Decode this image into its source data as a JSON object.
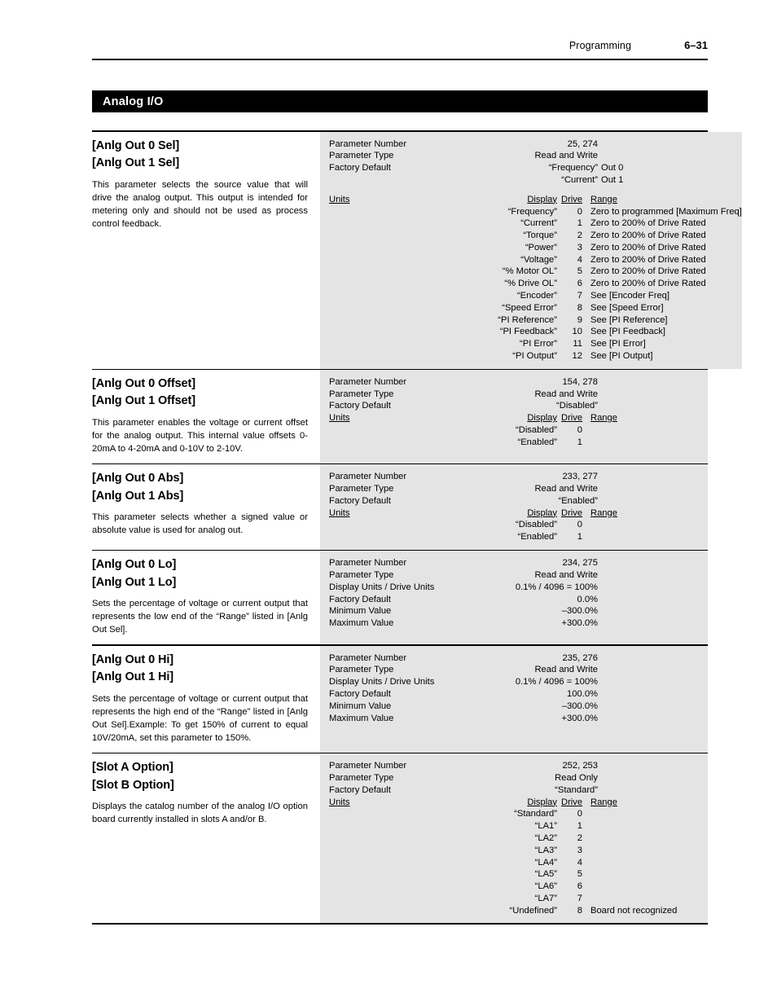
{
  "header": {
    "title": "Programming",
    "folio": "6–31"
  },
  "section": {
    "title": "Analog I/O"
  },
  "labels": {
    "parameter_number": "Parameter Number",
    "parameter_type": "Parameter Type",
    "factory_default": "Factory Default",
    "display_units_drive_units": "Display Units / Drive Units",
    "minimum_value": "Minimum Value",
    "maximum_value": "Maximum Value",
    "units": "Units",
    "col_display": "Display",
    "col_drive": "Drive",
    "col_range": "Range"
  },
  "blocks": [
    {
      "names": [
        "[Anlg Out 0 Sel]",
        "[Anlg Out 1 Sel]"
      ],
      "description": "This parameter selects the source value that will drive the analog output. This output is intended for metering only and should not be used as process control feedback.",
      "parameter_number": "25, 274",
      "parameter_type": "Read and Write",
      "factory_defaults": [
        {
          "value": "“Frequency”",
          "suffix": "Out 0"
        },
        {
          "value": "“Current”",
          "suffix": "Out 1"
        }
      ],
      "has_range_column": true,
      "enums": [
        {
          "display": "“Frequency”",
          "drive": "0",
          "range": "Zero to programmed [Maximum Freq]"
        },
        {
          "display": "“Current”",
          "drive": "1",
          "range": "Zero to 200% of Drive Rated"
        },
        {
          "display": "“Torque”",
          "drive": "2",
          "range": "Zero to 200% of Drive Rated"
        },
        {
          "display": "“Power”",
          "drive": "3",
          "range": "Zero to 200% of Drive Rated"
        },
        {
          "display": "“Voltage”",
          "drive": "4",
          "range": "Zero to 200% of Drive Rated"
        },
        {
          "display": "“% Motor OL”",
          "drive": "5",
          "range": "Zero to 200% of Drive Rated"
        },
        {
          "display": "“% Drive OL”",
          "drive": "6",
          "range": "Zero to 200% of Drive Rated"
        },
        {
          "display": "“Encoder”",
          "drive": "7",
          "range": "See [Encoder Freq]"
        },
        {
          "display": "“Speed Error”",
          "drive": "8",
          "range": "See [Speed Error]"
        },
        {
          "display": "“PI Reference”",
          "drive": "9",
          "range": "See [PI Reference]"
        },
        {
          "display": "“PI Feedback”",
          "drive": "10",
          "range": "See [PI Feedback]"
        },
        {
          "display": "“PI Error”",
          "drive": "11",
          "range": "See [PI Error]"
        },
        {
          "display": "“PI Output”",
          "drive": "12",
          "range": "See [PI Output]"
        }
      ]
    },
    {
      "names": [
        "[Anlg Out 0 Offset]",
        "[Anlg Out 1 Offset]"
      ],
      "description": "This parameter enables the voltage or current offset for the analog output. This internal value offsets 0-20mA to 4-20mA and 0-10V to 2-10V.",
      "parameter_number": "154, 278",
      "parameter_type": "Read and Write",
      "factory_defaults": [
        {
          "value": "“Disabled”",
          "suffix": ""
        }
      ],
      "has_range_column": false,
      "enums": [
        {
          "display": "“Disabled”",
          "drive": "0",
          "range": ""
        },
        {
          "display": "“Enabled”",
          "drive": "1",
          "range": ""
        }
      ]
    },
    {
      "names": [
        "[Anlg Out 0 Abs]",
        "[Anlg Out 1 Abs]"
      ],
      "description": "This parameter selects whether a signed value or absolute value is used for analog out.",
      "parameter_number": "233, 277",
      "parameter_type": "Read and Write",
      "factory_defaults": [
        {
          "value": "“Enabled”",
          "suffix": ""
        }
      ],
      "has_range_column": false,
      "enums": [
        {
          "display": "“Disabled”",
          "drive": "0",
          "range": ""
        },
        {
          "display": "“Enabled”",
          "drive": "1",
          "range": ""
        }
      ]
    },
    {
      "names": [
        "[Anlg Out 0 Lo]",
        "[Anlg Out 1 Lo]"
      ],
      "description": "Sets the percentage of voltage or current output that represents the low end of the “Range” listed in [Anlg Out Sel].",
      "parameter_number": "234, 275",
      "parameter_type": "Read and Write",
      "display_units": "0.1% / 4096 = 100%",
      "factory_default_simple": "0.0%",
      "minimum_value": "–300.0%",
      "maximum_value": "+300.0%"
    },
    {
      "names": [
        "[Anlg Out 0 Hi]",
        "[Anlg Out 1 Hi]"
      ],
      "description": "Sets the percentage of voltage or current output that represents the high end of the “Range” listed in [Anlg Out Sel].Example: To get 150% of current to equal 10V/20mA, set this parameter to 150%.",
      "parameter_number": "235, 276",
      "parameter_type": "Read and Write",
      "display_units": "0.1% / 4096 = 100%",
      "factory_default_simple": "100.0%",
      "minimum_value": "–300.0%",
      "maximum_value": "+300.0%"
    },
    {
      "names": [
        "[Slot A Option]",
        "[Slot B Option]"
      ],
      "description": "Displays the catalog number of the analog I/O option board currently installed in slots A and/or B.",
      "parameter_number": "252, 253",
      "parameter_type": "Read Only",
      "factory_defaults": [
        {
          "value": "“Standard”",
          "suffix": ""
        }
      ],
      "has_range_column": false,
      "enums": [
        {
          "display": "“Standard”",
          "drive": "0",
          "range": ""
        },
        {
          "display": "“LA1”",
          "drive": "1",
          "range": ""
        },
        {
          "display": "“LA2”",
          "drive": "2",
          "range": ""
        },
        {
          "display": "“LA3”",
          "drive": "3",
          "range": ""
        },
        {
          "display": "“LA4”",
          "drive": "4",
          "range": ""
        },
        {
          "display": "“LA5”",
          "drive": "5",
          "range": ""
        },
        {
          "display": "“LA6”",
          "drive": "6",
          "range": ""
        },
        {
          "display": "“LA7”",
          "drive": "7",
          "range": ""
        },
        {
          "display": "“Undefined”",
          "drive": "8",
          "range": "Board not recognized"
        }
      ]
    }
  ]
}
